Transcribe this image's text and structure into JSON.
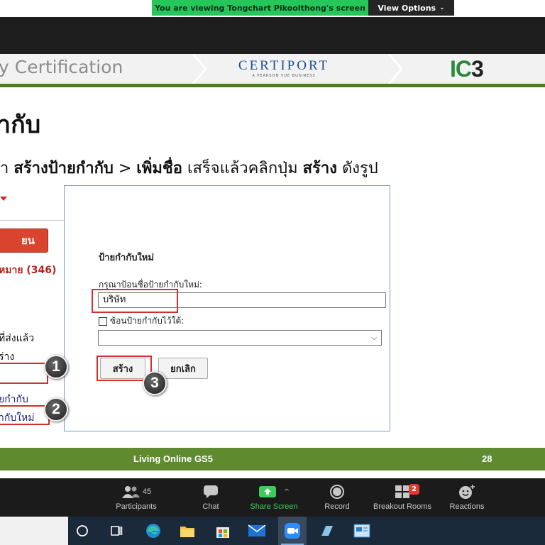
{
  "zoom": {
    "viewing_banner": "You are viewing Tongchart Pikoolthong's screen",
    "view_options": "View Options",
    "toolbar": {
      "participants": {
        "label": "Participants",
        "count": "45"
      },
      "chat": {
        "label": "Chat"
      },
      "share": {
        "label": "Share Screen"
      },
      "record": {
        "label": "Record"
      },
      "breakout": {
        "label": "Breakout Rooms",
        "badge": "2"
      },
      "reactions": {
        "label": "Reactions"
      }
    }
  },
  "slide": {
    "header": {
      "left_text": "y Certification",
      "certiport": "CERTIPORT",
      "certiport_sub": "A PEARSON VUE BUSINESS",
      "ic3_a": "IC",
      "ic3_b": "3"
    },
    "title": "ำกับ",
    "instruction": {
      "p1": "า ",
      "b1": "สร้างป้ายกำกับ",
      "p2": " > ",
      "b2": "เพิ่มชื่อ",
      "p3": " เสร็จแล้วคลิกปุ่ม ",
      "b3": "สร้าง",
      "p4": " ดังรูป"
    },
    "sidebar": {
      "compose": "ยน",
      "inbox": "หมาย (346)",
      "sent": "ที่ส่งแล้ว",
      "drafts": "ร่าง",
      "labels": "ยกำกับ",
      "new_label": "ำกับใหม่"
    },
    "dialog": {
      "title": "ป้ายกำกับใหม่",
      "prompt": "กรุณาป้อนชื่อป้ายกำกับใหม่:",
      "name_value": "บริษัท",
      "nest_label": "ซ้อนป้ายกำกับไว้ใต้:",
      "create": "สร้าง",
      "cancel": "ยกเลิก"
    },
    "steps": [
      "1",
      "2",
      "3"
    ],
    "footer": {
      "title": "Living Online GS5",
      "page": "28"
    }
  },
  "colors": {
    "banner_green": "#27c65a",
    "slide_green": "#5f8a2f",
    "highlight_red": "#d32f2f",
    "compose_red": "#d9442f"
  }
}
